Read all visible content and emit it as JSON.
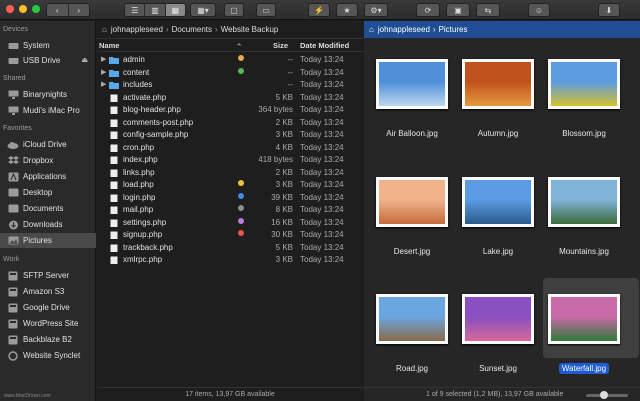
{
  "toolbar": {
    "colors": {
      "close": "#fe5f57",
      "minimize": "#febc2e",
      "zoom": "#28c840"
    }
  },
  "sidebar": {
    "sections": [
      {
        "title": "Devices",
        "items": [
          {
            "label": "System",
            "icon": "hard-drive-icon"
          },
          {
            "label": "USB Drive",
            "icon": "hard-drive-icon",
            "eject": "⏏"
          }
        ]
      },
      {
        "title": "Shared",
        "items": [
          {
            "label": "Binarynights",
            "icon": "display-icon"
          },
          {
            "label": "Mudi's iMac Pro",
            "icon": "display-icon"
          }
        ]
      },
      {
        "title": "Favorites",
        "items": [
          {
            "label": "iCloud Drive",
            "icon": "cloud-icon"
          },
          {
            "label": "Dropbox",
            "icon": "dropbox-icon"
          },
          {
            "label": "Applications",
            "icon": "applications-icon"
          },
          {
            "label": "Desktop",
            "icon": "desktop-icon"
          },
          {
            "label": "Documents",
            "icon": "documents-icon"
          },
          {
            "label": "Downloads",
            "icon": "downloads-icon"
          },
          {
            "label": "Pictures",
            "icon": "pictures-icon",
            "selected": true
          }
        ]
      },
      {
        "title": "Work",
        "items": [
          {
            "label": "SFTP Server",
            "icon": "server-icon"
          },
          {
            "label": "Amazon S3",
            "icon": "server-icon"
          },
          {
            "label": "Google Drive",
            "icon": "server-icon"
          },
          {
            "label": "WordPress Site",
            "icon": "server-icon"
          },
          {
            "label": "Backblaze B2",
            "icon": "server-icon"
          },
          {
            "label": "Website Synclet",
            "icon": "synclet-icon"
          }
        ]
      }
    ]
  },
  "left_pane": {
    "breadcrumb": [
      "johnappleseed",
      "Documents",
      "Website Backup"
    ],
    "columns": {
      "name": "Name",
      "size": "Size",
      "date": "Date Modified",
      "sort_indicator": "⌃"
    },
    "files": [
      {
        "name": "admin",
        "size": "--",
        "date": "Today 13:24",
        "folder": true,
        "tag": "#e8a94a"
      },
      {
        "name": "content",
        "size": "--",
        "date": "Today 13:24",
        "folder": true,
        "tag": "#57b94e"
      },
      {
        "name": "includes",
        "size": "--",
        "date": "Today 13:24",
        "folder": true,
        "tag": ""
      },
      {
        "name": "activate.php",
        "size": "5 KB",
        "date": "Today 13:24",
        "folder": false,
        "tag": ""
      },
      {
        "name": "blog-header.php",
        "size": "364 bytes",
        "date": "Today 13:24",
        "folder": false,
        "tag": ""
      },
      {
        "name": "comments-post.php",
        "size": "2 KB",
        "date": "Today 13:24",
        "folder": false,
        "tag": ""
      },
      {
        "name": "config-sample.php",
        "size": "3 KB",
        "date": "Today 13:24",
        "folder": false,
        "tag": ""
      },
      {
        "name": "cron.php",
        "size": "4 KB",
        "date": "Today 13:24",
        "folder": false,
        "tag": ""
      },
      {
        "name": "index.php",
        "size": "418 bytes",
        "date": "Today 13:24",
        "folder": false,
        "tag": ""
      },
      {
        "name": "links.php",
        "size": "2 KB",
        "date": "Today 13:24",
        "folder": false,
        "tag": ""
      },
      {
        "name": "load.php",
        "size": "3 KB",
        "date": "Today 13:24",
        "folder": false,
        "tag": "#f0c33c"
      },
      {
        "name": "login.php",
        "size": "39 KB",
        "date": "Today 13:24",
        "folder": false,
        "tag": "#3a8fe6"
      },
      {
        "name": "mail.php",
        "size": "8 KB",
        "date": "Today 13:24",
        "folder": false,
        "tag": "#8e8e93"
      },
      {
        "name": "settings.php",
        "size": "16 KB",
        "date": "Today 13:24",
        "folder": false,
        "tag": "#b57de0"
      },
      {
        "name": "signup.php",
        "size": "30 KB",
        "date": "Today 13:24",
        "folder": false,
        "tag": "#e8574a"
      },
      {
        "name": "trackback.php",
        "size": "5 KB",
        "date": "Today 13:24",
        "folder": false,
        "tag": ""
      },
      {
        "name": "xmlrpc.php",
        "size": "3 KB",
        "date": "Today 13:24",
        "folder": false,
        "tag": ""
      }
    ],
    "status": "17 items, 13,97 GB available"
  },
  "right_pane": {
    "breadcrumb": [
      "johnappleseed",
      "Pictures"
    ],
    "images": [
      {
        "name": "Air Balloon.jpg",
        "colors": [
          "#4f8fd8",
          "#bcd7f0"
        ],
        "selected": false
      },
      {
        "name": "Autumn.jpg",
        "colors": [
          "#c0521d",
          "#e79a3c"
        ],
        "selected": false
      },
      {
        "name": "Blossom.jpg",
        "colors": [
          "#5b9be0",
          "#d6c02c"
        ],
        "selected": false
      },
      {
        "name": "Desert.jpg",
        "colors": [
          "#f0b38a",
          "#c46a3c"
        ],
        "selected": false
      },
      {
        "name": "Lake.jpg",
        "colors": [
          "#5a9be2",
          "#2a5c8a"
        ],
        "selected": false
      },
      {
        "name": "Mountains.jpg",
        "colors": [
          "#7fb3d8",
          "#3b6b3a"
        ],
        "selected": false
      },
      {
        "name": "Road.jpg",
        "colors": [
          "#6aa6e0",
          "#8a6a4a"
        ],
        "selected": false
      },
      {
        "name": "Sunset.jpg",
        "colors": [
          "#8a4fc0",
          "#d66a9a"
        ],
        "selected": false
      },
      {
        "name": "Waterfall.jpg",
        "colors": [
          "#c86aa8",
          "#2e7a3a"
        ],
        "selected": true
      }
    ],
    "status": "1 of 9 selected (1,2 MB), 13,97 GB available"
  },
  "watermark": "www.MacDrown.com"
}
